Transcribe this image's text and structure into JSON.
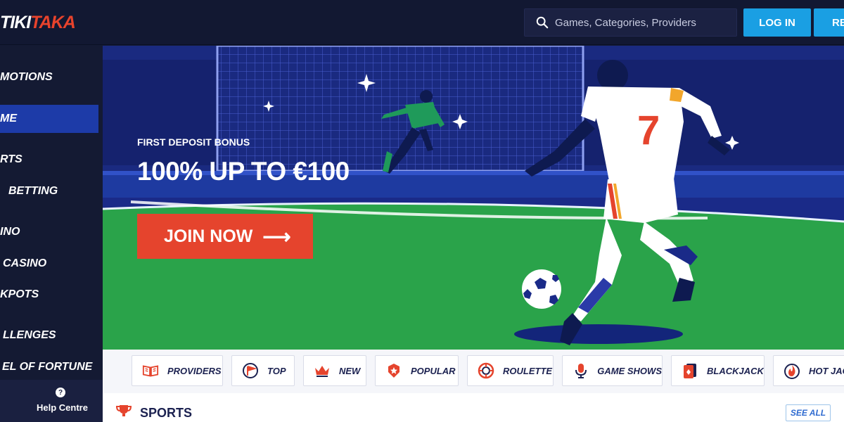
{
  "header": {
    "logo_part1": "TIKI",
    "logo_part2": "TAKA",
    "search_placeholder": "Games, Categories, Providers",
    "login_label": "LOG IN",
    "register_label": "RE"
  },
  "sidebar": {
    "items": [
      {
        "label": "MOTIONS",
        "icon": "promotions-icon"
      },
      {
        "label": "ME",
        "icon": "home-icon",
        "active": true
      },
      {
        "label": "RTS",
        "icon": "sports-icon"
      },
      {
        "label": "BETTING",
        "icon": "live-betting-icon"
      },
      {
        "label": "INO",
        "icon": "casino-icon"
      },
      {
        "label": "CASINO",
        "icon": "live-casino-icon"
      },
      {
        "label": "KPOTS",
        "icon": "jackpots-icon"
      },
      {
        "label": "LLENGES",
        "icon": "challenges-icon"
      },
      {
        "label": "EL OF FORTUNE",
        "icon": "wheel-of-fortune-icon"
      }
    ],
    "help_label": "Help Centre"
  },
  "hero": {
    "subtitle": "FIRST DEPOSIT BONUS",
    "title": "100% UP TO €100",
    "cta_label": "JOIN NOW",
    "player_number": "7"
  },
  "categories": [
    {
      "label": "PROVIDERS",
      "icon": "book-icon"
    },
    {
      "label": "TOP",
      "icon": "flag-icon"
    },
    {
      "label": "NEW",
      "icon": "crown-icon"
    },
    {
      "label": "POPULAR",
      "icon": "star-badge-icon"
    },
    {
      "label": "ROULETTE",
      "icon": "roulette-icon"
    },
    {
      "label": "GAME SHOWS",
      "icon": "microphone-icon"
    },
    {
      "label": "BLACKJACK",
      "icon": "card-icon"
    },
    {
      "label": "HOT JACK",
      "icon": "flame-icon"
    }
  ],
  "sports_section": {
    "title": "SPORTS",
    "see_all_label": "SEE ALL"
  },
  "colors": {
    "accent_blue": "#1a9fe3",
    "cta_red": "#e5442d",
    "active_nav": "#1d3ba8"
  }
}
